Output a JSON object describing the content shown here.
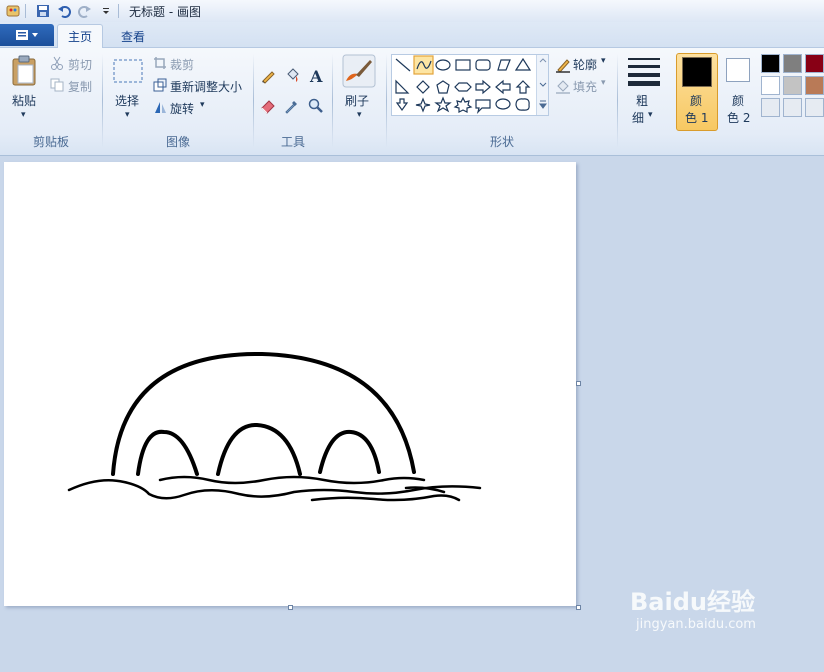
{
  "titlebar": {
    "title": "无标题 - 画图"
  },
  "tabs": [
    {
      "label": "主页"
    },
    {
      "label": "查看"
    }
  ],
  "clipboard": {
    "paste": "粘贴",
    "cut": "剪切",
    "copy": "复制",
    "group": "剪贴板"
  },
  "image": {
    "select": "选择",
    "crop": "裁剪",
    "resize": "重新调整大小",
    "rotate": "旋转",
    "group": "图像"
  },
  "tools": {
    "group": "工具"
  },
  "brushes": {
    "label": "刷子"
  },
  "shapes": {
    "outline": "轮廓",
    "fill": "填充",
    "group": "形状"
  },
  "size": {
    "line1": "粗",
    "line2": "细"
  },
  "colors": {
    "color1_line1": "颜",
    "color1_line2": "色 1",
    "color1_value": "#000000",
    "color2_line1": "颜",
    "color2_line2": "色 2",
    "color2_value": "#ffffff",
    "palette": [
      "#000000",
      "#7f7f7f",
      "#880015",
      "#ffffff",
      "#c3c3c3",
      "#b97a57",
      "#e6ebf2",
      "#e6ebf2",
      "#e6ebf2"
    ]
  },
  "watermark": {
    "brand": "Baidu经验",
    "url": "jingyan.baidu.com"
  }
}
